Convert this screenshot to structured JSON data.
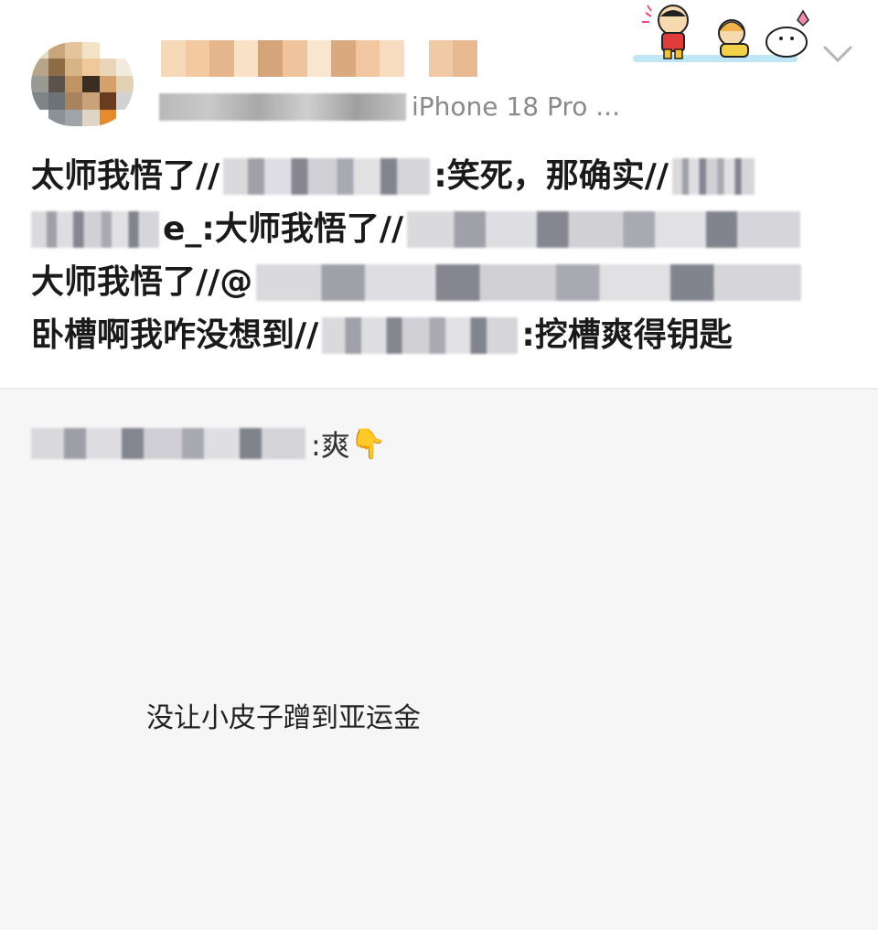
{
  "header": {
    "meta_text": "iPhone 18 Pro ...",
    "sticker_icon": "crayon-shinchan-sticker",
    "menu_icon": "chevron-down-icon"
  },
  "post": {
    "lines": [
      {
        "before": "太师我悟了//",
        "after": ":笑死，那确实//"
      },
      {
        "before": "e_:大师我悟了//",
        "after": ""
      },
      {
        "before": "大师我悟了//@",
        "after": ""
      },
      {
        "before": "卧槽啊我咋没想到//",
        "after": ":挖槽爽得钥匙"
      }
    ]
  },
  "reply": {
    "text": ":爽",
    "emoji": "👇"
  },
  "image_caption": "没让小皮子蹭到亚运金"
}
